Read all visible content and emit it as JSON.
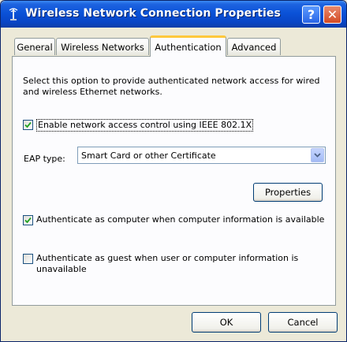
{
  "window": {
    "title": "Wireless Network Connection Properties",
    "help_label": "?",
    "close_label": "✕"
  },
  "tabs": [
    {
      "label": "General"
    },
    {
      "label": "Wireless Networks"
    },
    {
      "label": "Authentication"
    },
    {
      "label": "Advanced"
    }
  ],
  "active_tab": "Authentication",
  "authentication": {
    "description": "Select this option to provide authenticated network access for wired and wireless Ethernet networks.",
    "enable_8021x": {
      "label": "Enable network access control using IEEE 802.1X",
      "checked": true
    },
    "eap_type_label": "EAP type:",
    "eap_type_value": "Smart Card or other Certificate",
    "properties_label": "Properties",
    "auth_as_computer": {
      "label": "Authenticate as computer when computer information is available",
      "checked": true
    },
    "auth_as_guest": {
      "label": "Authenticate as guest when user or computer information is unavailable",
      "checked": false
    }
  },
  "footer": {
    "ok_label": "OK",
    "cancel_label": "Cancel"
  },
  "colors": {
    "titlebar": "#0a52d8",
    "face": "#ece9d8",
    "tab_highlight": "#ffc83c"
  }
}
